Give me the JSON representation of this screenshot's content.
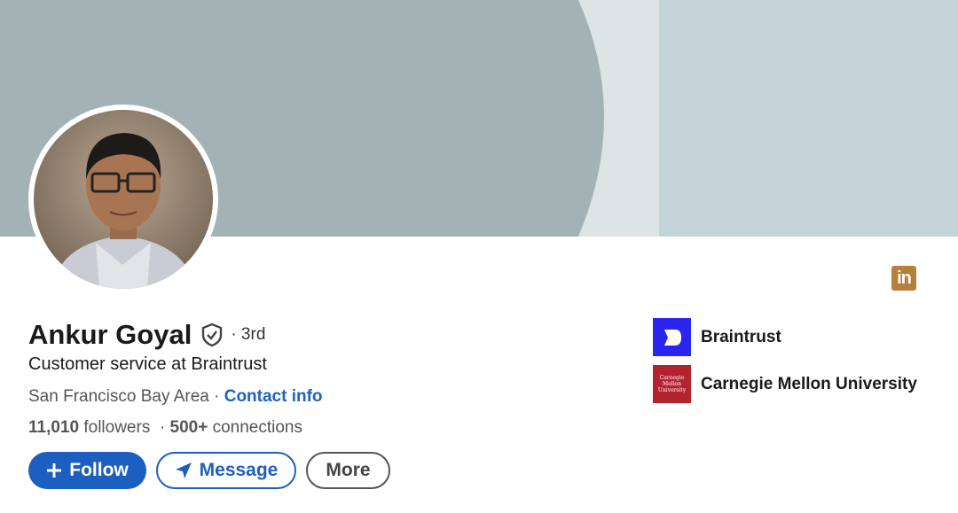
{
  "banner": {
    "colors": {
      "dark": "#a3b3b5",
      "mid": "#dce4e6",
      "light": "#c3d3d7"
    }
  },
  "avatar": {
    "alt": "Profile photo"
  },
  "profile": {
    "name": "Ankur Goyal",
    "degree": "· 3rd",
    "headline": "Customer service at Braintrust",
    "location": "San Francisco Bay Area",
    "separator": " · ",
    "contact_label": "Contact info",
    "followers_count": "11,010",
    "followers_label": "followers",
    "stats_separator": "·",
    "connections_count": "500+",
    "connections_label": "connections"
  },
  "badge": {
    "text": "in"
  },
  "actions": {
    "follow_label": "Follow",
    "message_label": "Message",
    "more_label": "More"
  },
  "orgs": [
    {
      "name": "Braintrust",
      "icon": "braintrust-logo",
      "color": "#2b25f0"
    },
    {
      "name": "Carnegie Mellon University",
      "icon": "cmu-logo",
      "color": "#b3222f",
      "logo_text": [
        "Carnegie",
        "Mellon",
        "University"
      ]
    }
  ],
  "colors": {
    "accent": "#1d5fc0",
    "link": "#1d63c3",
    "badge": "#b3823a"
  }
}
